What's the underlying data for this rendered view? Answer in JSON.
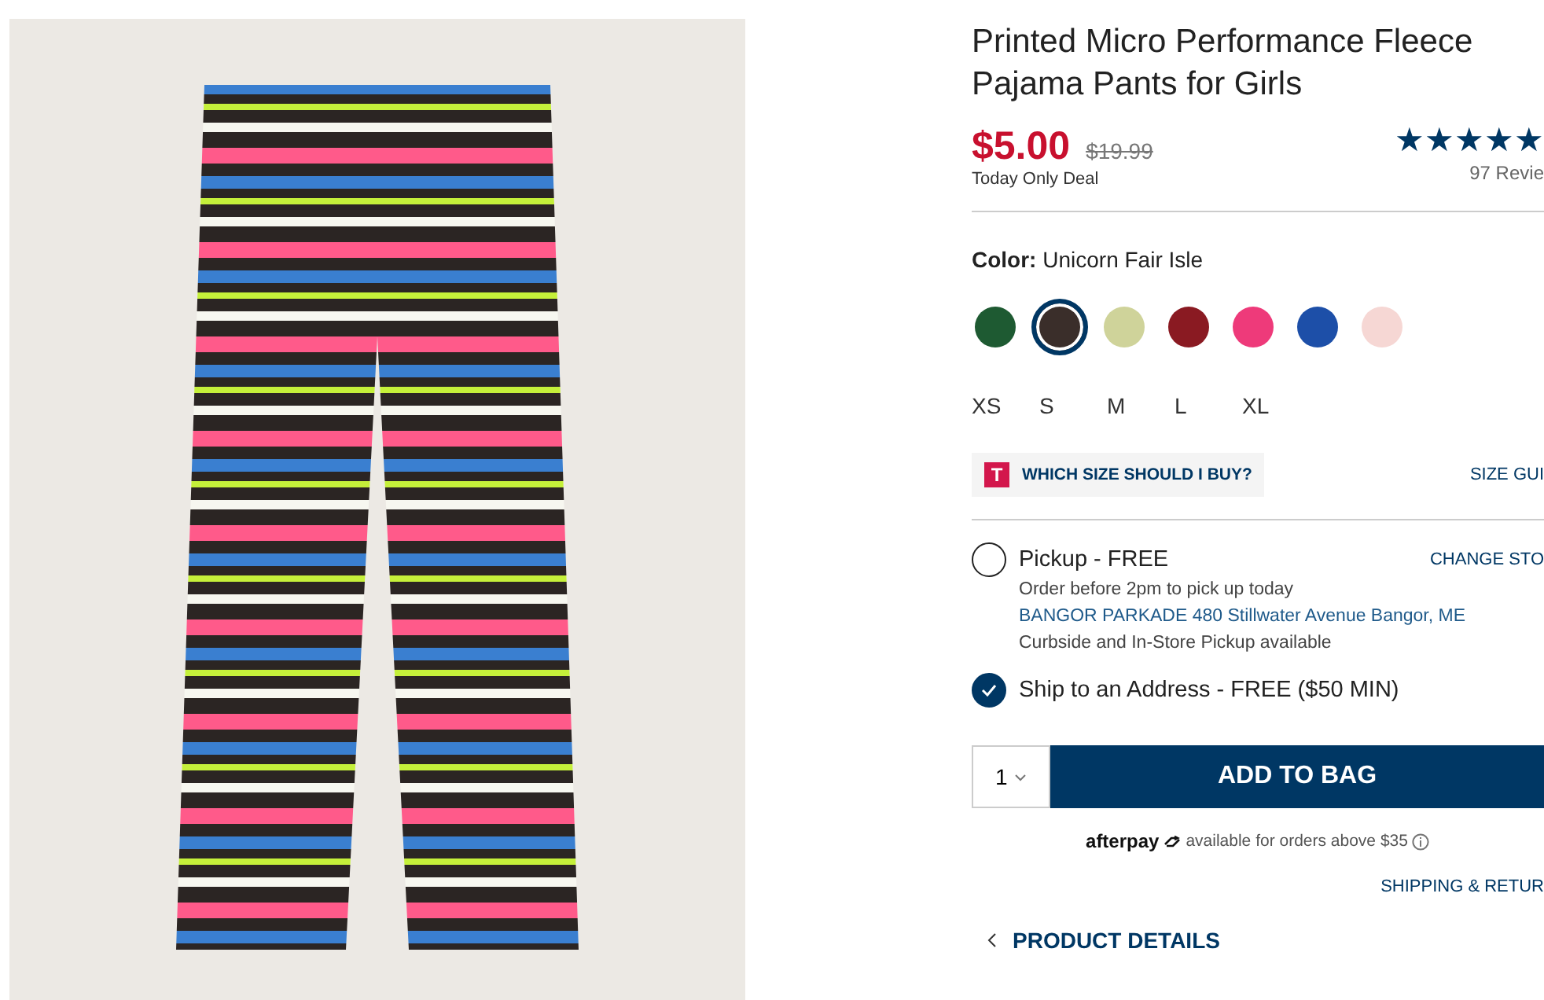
{
  "title": "Printed Micro Performance Fleece Pajama Pants for Girls",
  "price": {
    "sale": "$5.00",
    "original": "$19.99",
    "note": "Today Only Deal"
  },
  "rating": {
    "stars": 5,
    "reviews": "97 Revie"
  },
  "color": {
    "label": "Color:",
    "value": "Unicorn Fair Isle"
  },
  "swatches": [
    {
      "color": "#1e5a32",
      "selected": false
    },
    {
      "color": "#3a2e2a",
      "selected": true
    },
    {
      "color": "#cfd39a",
      "selected": false
    },
    {
      "color": "#8a1a22",
      "selected": false
    },
    {
      "color": "#ee3a7a",
      "selected": false
    },
    {
      "color": "#1d4fa8",
      "selected": false
    },
    {
      "color": "#f6d7d4",
      "selected": false
    }
  ],
  "sizes": [
    {
      "label": "XS",
      "selected": false
    },
    {
      "label": "S",
      "selected": false
    },
    {
      "label": "M",
      "selected": false
    },
    {
      "label": "L",
      "selected": false
    },
    {
      "label": "XL",
      "selected": false
    }
  ],
  "size_help": {
    "badge": "T",
    "label": "WHICH SIZE SHOULD I BUY?",
    "guide": "SIZE GUI"
  },
  "fulfillment": [
    {
      "label": "Pickup - FREE",
      "selected": false,
      "action": "CHANGE STO",
      "lines": [
        {
          "kind": "note",
          "text": "Order before 2pm to pick up today"
        },
        {
          "kind": "store",
          "text": "BANGOR PARKADE 480 Stillwater Avenue  Bangor, ME"
        },
        {
          "kind": "note",
          "text": "Curbside and In-Store Pickup available"
        }
      ]
    },
    {
      "label": "Ship to an Address - FREE ($50 MIN)",
      "selected": true
    }
  ],
  "quantity": "1",
  "add_button": "ADD TO BAG",
  "afterpay": {
    "brand": "afterpay",
    "text": "available for orders above $35"
  },
  "shipping_link": "SHIPPING & RETUR",
  "details_link": "PRODUCT DETAILS"
}
